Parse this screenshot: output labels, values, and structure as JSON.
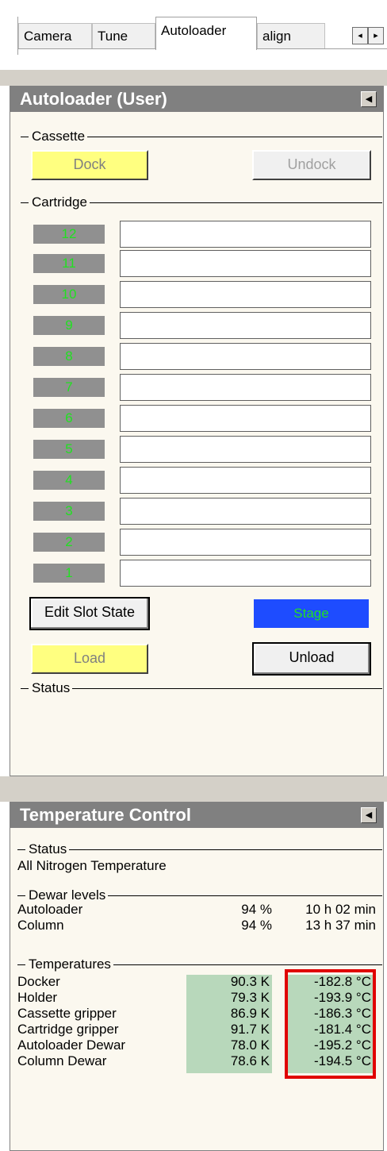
{
  "tabs": [
    {
      "label": "Camera"
    },
    {
      "label": "Tune"
    },
    {
      "label": "Autoloader",
      "active": true
    },
    {
      "label": "align"
    }
  ],
  "scroll_left": "◂",
  "scroll_right": "▸",
  "autoloader": {
    "title": "Autoloader (User)",
    "collapse_glyph": "◀",
    "cassette_label": "Cassette",
    "dock_label": "Dock",
    "undock_label": "Undock",
    "cartridge_label": "Cartridge",
    "slots": [
      "12",
      "11",
      "10",
      "9",
      "8",
      "7",
      "6",
      "5",
      "4",
      "3",
      "2",
      "1"
    ],
    "edit_slot_label": "Edit Slot State",
    "stage_label": "Stage",
    "load_label": "Load",
    "unload_label": "Unload",
    "status_label": "Status"
  },
  "temperature": {
    "title": "Temperature Control",
    "collapse_glyph": "◀",
    "status_label": "Status",
    "status_text": "All Nitrogen Temperature",
    "dewar_label": "Dewar levels",
    "dewars": [
      {
        "name": "Autoloader",
        "percent": "94 %",
        "time": "10 h 02 min"
      },
      {
        "name": "Column",
        "percent": "94 %",
        "time": "13 h 37 min"
      }
    ],
    "temps_label": "Temperatures",
    "temps": [
      {
        "name": "Docker",
        "kelvin": "90.3 K",
        "celsius": "-182.8 °C"
      },
      {
        "name": "Holder",
        "kelvin": "79.3 K",
        "celsius": "-193.9 °C"
      },
      {
        "name": "Cassette gripper",
        "kelvin": "86.9 K",
        "celsius": "-186.3 °C"
      },
      {
        "name": "Cartridge gripper",
        "kelvin": "91.7 K",
        "celsius": "-181.4 °C"
      },
      {
        "name": "Autoloader Dewar",
        "kelvin": "78.0 K",
        "celsius": "-195.2 °C"
      },
      {
        "name": "Column Dewar",
        "kelvin": "78.6 K",
        "celsius": "-194.5 °C"
      }
    ]
  },
  "colors": {
    "panel_header": "#808080",
    "panel_bg": "#fbf8ef",
    "dock_button": "#ffff80",
    "stage_bg": "#1e4cff",
    "slot_text": "#21e021",
    "kelvin_bg": "#b8d8bb",
    "highlight": "#e00000"
  }
}
